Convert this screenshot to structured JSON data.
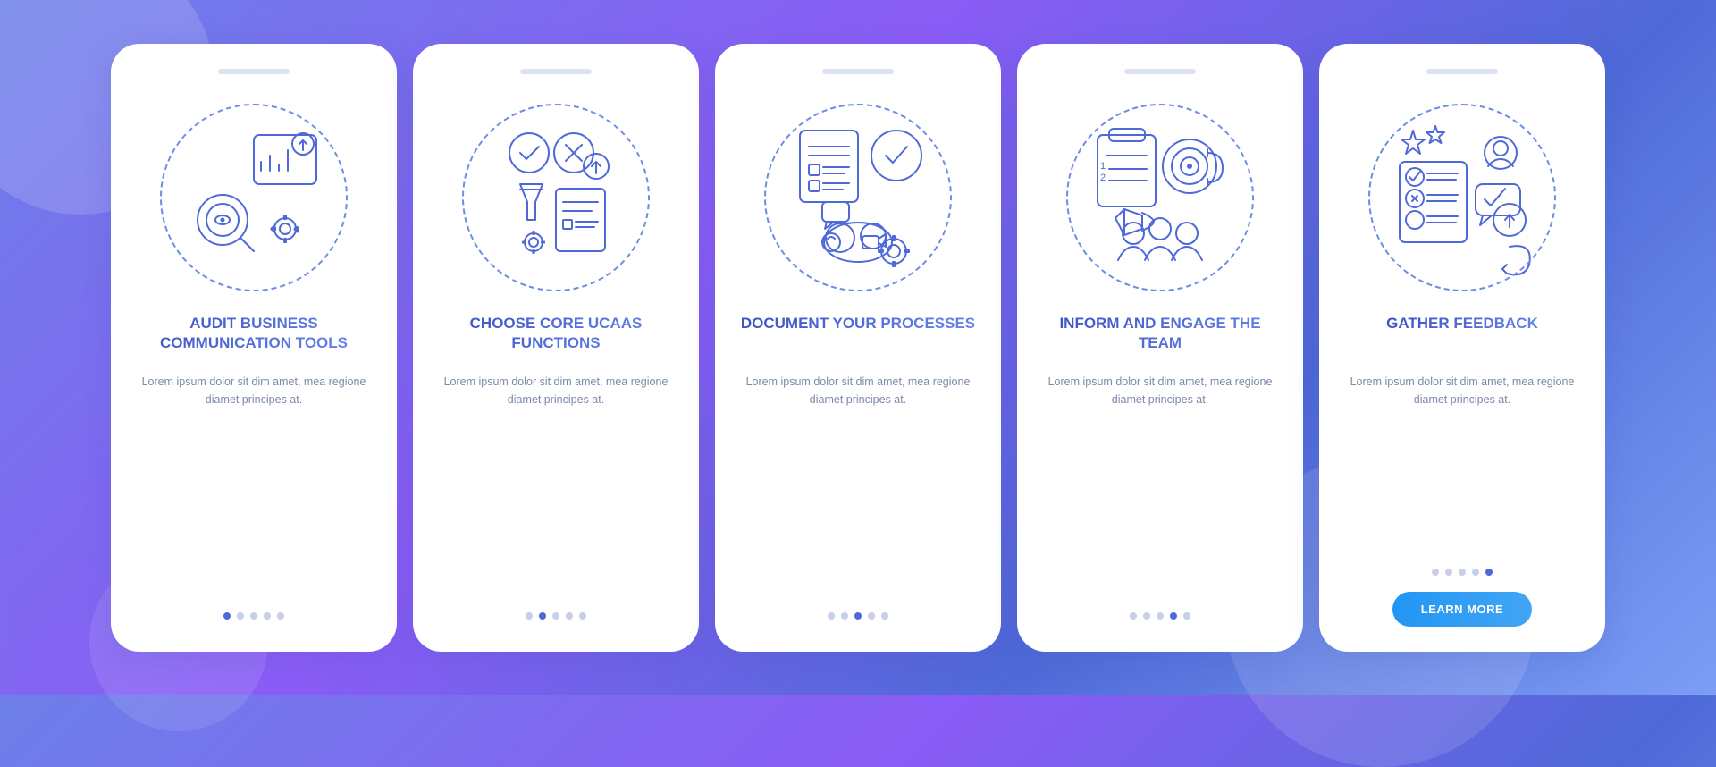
{
  "background": {
    "gradient_start": "#6c7fe8",
    "gradient_end": "#4f6ad8"
  },
  "cards": [
    {
      "id": "card-1",
      "title": "AUDIT BUSINESS COMMUNICATION TOOLS",
      "body": "Lorem ipsum dolor sit dim amet, mea regione diamet principes at.",
      "dots": [
        true,
        false,
        false,
        false,
        false
      ],
      "show_button": false,
      "button_label": ""
    },
    {
      "id": "card-2",
      "title": "CHOOSE CORE UCAAS FUNCTIONS",
      "body": "Lorem ipsum dolor sit dim amet, mea regione diamet principes at.",
      "dots": [
        false,
        true,
        false,
        false,
        false
      ],
      "show_button": false,
      "button_label": ""
    },
    {
      "id": "card-3",
      "title": "DOCUMENT YOUR PROCESSES",
      "body": "Lorem ipsum dolor sit dim amet, mea regione diamet principes at.",
      "dots": [
        false,
        false,
        true,
        false,
        false
      ],
      "show_button": false,
      "button_label": ""
    },
    {
      "id": "card-4",
      "title": "INFORM AND ENGAGE THE TEAM",
      "body": "Lorem ipsum dolor sit dim amet, mea regione diamet principes at.",
      "dots": [
        false,
        false,
        false,
        true,
        false
      ],
      "show_button": false,
      "button_label": ""
    },
    {
      "id": "card-5",
      "title": "GATHER FEEDBACK",
      "body": "Lorem ipsum dolor sit dim amet, mea regione diamet principes at.",
      "dots": [
        false,
        false,
        false,
        false,
        true
      ],
      "show_button": true,
      "button_label": "LEARN MORE"
    }
  ]
}
